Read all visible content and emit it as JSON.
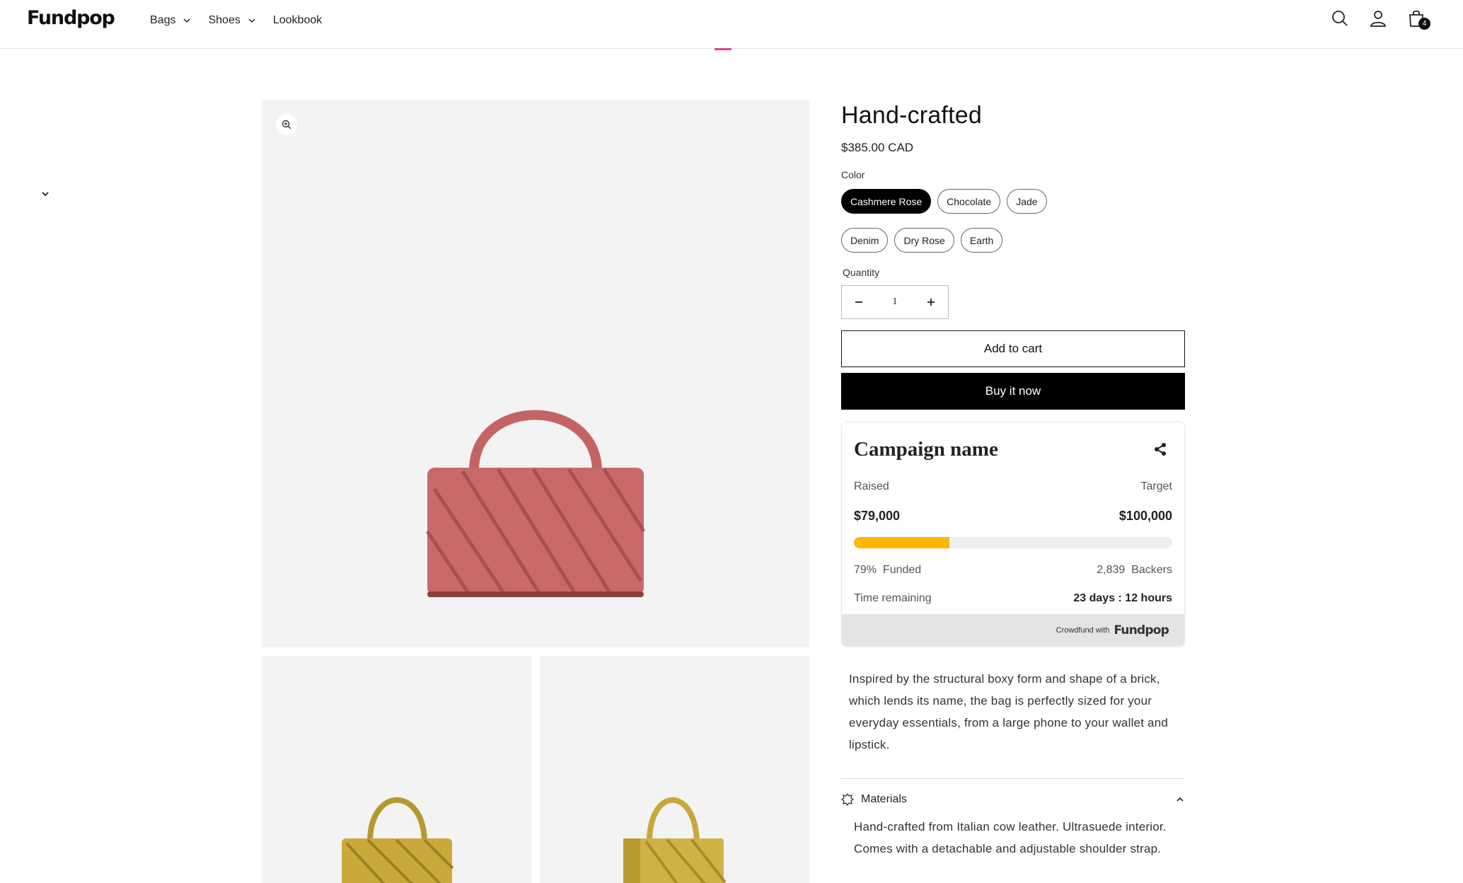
{
  "header": {
    "logo": "Fundpop",
    "nav": [
      {
        "label": "Bags",
        "has_dropdown": true
      },
      {
        "label": "Shoes",
        "has_dropdown": true
      },
      {
        "label": "Lookbook",
        "has_dropdown": false
      }
    ],
    "icons": [
      "search-icon",
      "account-icon",
      "cart-icon"
    ],
    "cart_count": "4"
  },
  "product": {
    "title": "Hand-crafted",
    "price": "$385.00 CAD",
    "color_label": "Color",
    "colors": [
      "Cashmere Rose",
      "Chocolate",
      "Jade",
      "Denim",
      "Dry Rose",
      "Earth"
    ],
    "selected_color": "Cashmere Rose",
    "quantity_label": "Quantity",
    "quantity": "1",
    "add_to_cart": "Add to cart",
    "buy_now": "Buy it now",
    "description": "Inspired by the structural boxy form and shape of a brick, which lends its name, the bag is perfectly sized for your everyday essentials, from a large phone to your wallet and lipstick.",
    "materials": {
      "title": "Materials",
      "text": "Hand-crafted from Italian cow leather. Ultrasuede interior. Comes with a detachable and adjustable shoulder strap."
    }
  },
  "campaign": {
    "name": "Campaign name",
    "raised_label": "Raised",
    "target_label": "Target",
    "raised": "$79,000",
    "target": "$100,000",
    "progress_fraction": 0.3,
    "funded_pct": "79%",
    "funded_label": "Funded",
    "backers": "2,839",
    "backers_label": "Backers",
    "time_label": "Time remaining",
    "time_value": "23 days : 12 hours",
    "footer_prefix": "Crowdfund with",
    "footer_brand": "Fundpop"
  },
  "colors": {
    "accent": "#fdb600",
    "bag_main": "#c96a68",
    "bag_alt": "#c9a93a",
    "nav_accent": "#e0409a"
  }
}
